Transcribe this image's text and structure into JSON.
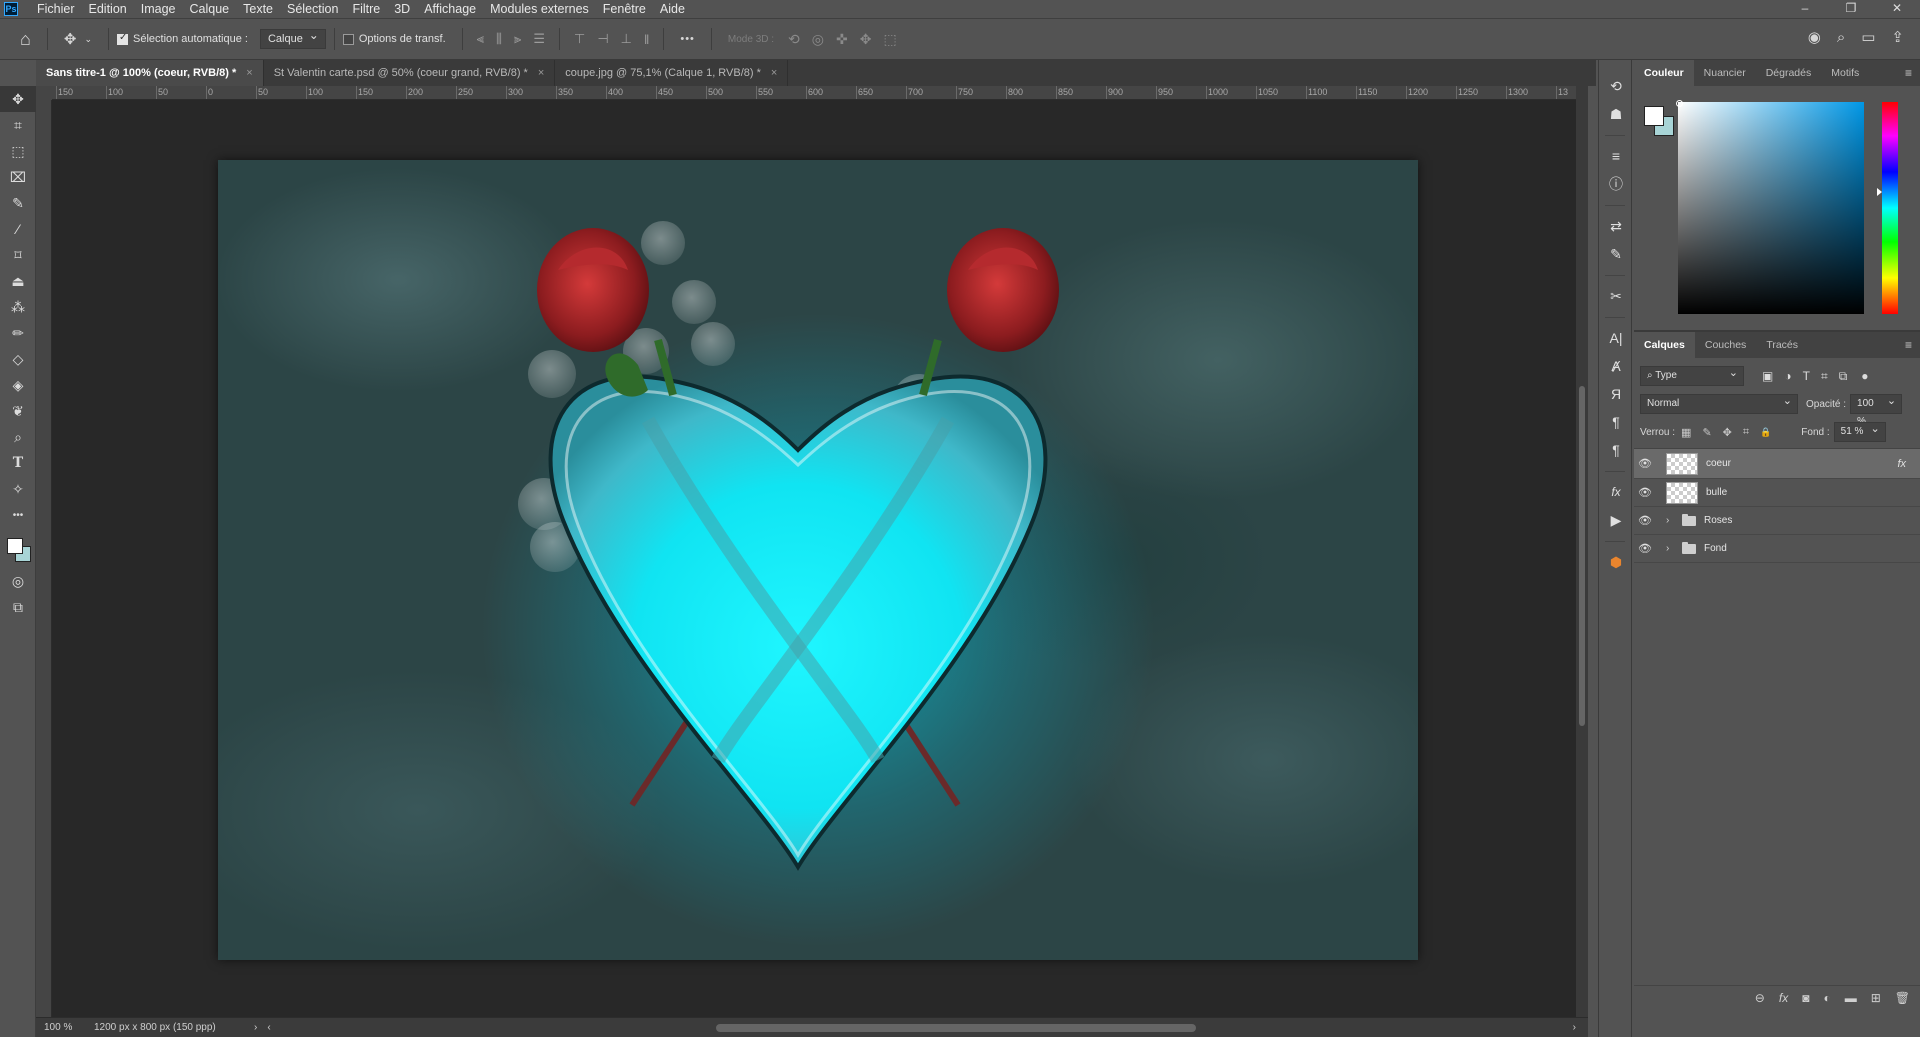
{
  "app": {
    "logo": "Ps"
  },
  "menu": [
    "Fichier",
    "Edition",
    "Image",
    "Calque",
    "Texte",
    "Sélection",
    "Filtre",
    "3D",
    "Affichage",
    "Modules externes",
    "Fenêtre",
    "Aide"
  ],
  "window_controls": {
    "minimize": "–",
    "restore": "❐",
    "close": "✕"
  },
  "options_bar": {
    "home_icon": "⌂",
    "move_icon": "✥",
    "auto_select_label": "Sélection automatique :",
    "auto_select_checked": true,
    "auto_select_target": "Calque",
    "transform_label": "Options de transf.",
    "transform_checked": false,
    "more_icon": "•••",
    "mode3d_label": "Mode 3D :",
    "right_icons": {
      "user": "◉",
      "search": "⌕",
      "workspace": "▭",
      "share": "⇪"
    }
  },
  "tabs": [
    {
      "label": "Sans titre-1 @ 100% (coeur, RVB/8) *",
      "active": true
    },
    {
      "label": "St Valentin carte.psd @ 50% (coeur grand, RVB/8) *",
      "active": false
    },
    {
      "label": "coupe.jpg @ 75,1% (Calque 1, RVB/8) *",
      "active": false
    }
  ],
  "tab_close": "×",
  "tools": [
    "✥",
    "⌗",
    "⬚",
    "⌧",
    "✎",
    "⁄",
    "⌑",
    "⏏",
    "⁂",
    "✏",
    "◇",
    "◈",
    "❦",
    "⌕",
    "T",
    "✧",
    "•••"
  ],
  "tools_bottom": [
    "◎",
    "⧉"
  ],
  "ruler_ticks": [
    "150",
    "100",
    "50",
    "0",
    "50",
    "100",
    "150",
    "200",
    "250",
    "300",
    "350",
    "400",
    "450",
    "500",
    "550",
    "600",
    "650",
    "700",
    "750",
    "800",
    "850",
    "900",
    "950",
    "1000",
    "1050",
    "1100",
    "1150",
    "1200",
    "1250",
    "1300",
    "13"
  ],
  "status": {
    "zoom": "100 %",
    "doc_info": "1200 px x 800 px (150 ppp)",
    "arrow": "›",
    "scroll_left": "‹",
    "scroll_right": "›"
  },
  "icon_strip": [
    "⟲",
    "☗",
    "≡",
    "ⓘ",
    "⇄",
    "✎",
    "✂",
    "A|",
    "Ⱥ",
    "Я",
    "¶",
    "¶",
    "fx",
    "▶",
    "⬢"
  ],
  "color_panel": {
    "tabs": [
      "Couleur",
      "Nuancier",
      "Dégradés",
      "Motifs"
    ],
    "menu_icon": "≡",
    "fg_color": "#ffffff",
    "bg_color": "#a8d4d6"
  },
  "layers_panel": {
    "tabs": [
      "Calques",
      "Couches",
      "Tracés"
    ],
    "menu_icon": "≡",
    "filter_type": "Type",
    "filter_icons": [
      "▣",
      "◑",
      "T",
      "⌗",
      "⧉"
    ],
    "blend_mode": "Normal",
    "opacity_label": "Opacité :",
    "opacity_value": "100 %",
    "lock_label": "Verrou :",
    "lock_icons": [
      "▦",
      "✎",
      "✥",
      "⌗",
      "🔒"
    ],
    "fill_label": "Fond :",
    "fill_value": "51 %",
    "layers": [
      {
        "name": "coeur",
        "type": "layer",
        "selected": true,
        "fx": "fx"
      },
      {
        "name": "bulle",
        "type": "layer",
        "selected": false
      },
      {
        "name": "Roses",
        "type": "group",
        "selected": false
      },
      {
        "name": "Fond",
        "type": "group",
        "selected": false
      }
    ],
    "eye_icon": "👁",
    "chevron": "›",
    "footer_icons": [
      "⊖",
      "fx",
      "◙",
      "◐",
      "▬",
      "⊞",
      "🗑"
    ]
  }
}
